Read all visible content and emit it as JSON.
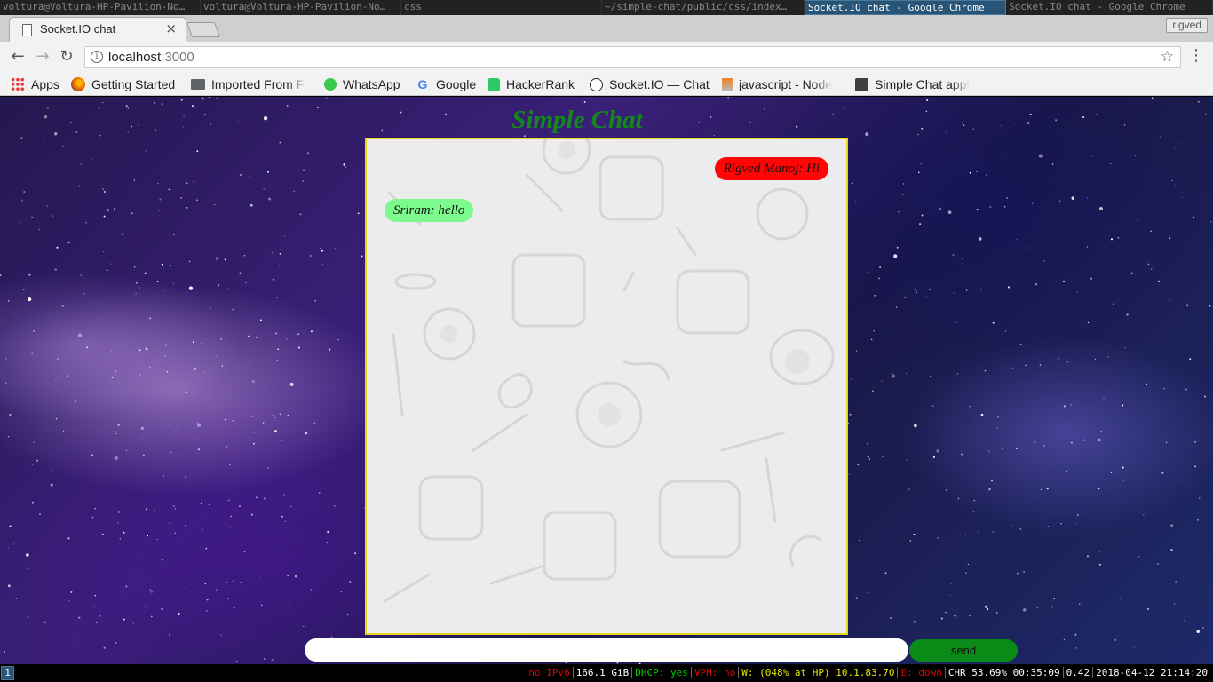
{
  "wm": {
    "titles": [
      "voltura@Voltura-HP-Pavilion-No…",
      "voltura@Voltura-HP-Pavilion-No…",
      "css",
      "~/simple-chat/public/css/index…",
      "Socket.IO chat - Google Chrome",
      "Socket.IO chat - Google Chrome"
    ]
  },
  "browser": {
    "tab_title": "Socket.IO chat",
    "profile_name": "rigved",
    "url_host": "localhost",
    "url_port": ":3000",
    "bookmarks": [
      {
        "label": "Apps",
        "icon": "apps-grid-icon"
      },
      {
        "label": "Getting Started",
        "icon": "firefox-icon"
      },
      {
        "label": "Imported From Fi",
        "icon": "folder-icon"
      },
      {
        "label": "WhatsApp",
        "icon": "whatsapp-icon"
      },
      {
        "label": "Google",
        "icon": "google-icon"
      },
      {
        "label": "HackerRank",
        "icon": "hackerrank-icon"
      },
      {
        "label": "Socket.IO — Chat",
        "icon": "socketio-icon"
      },
      {
        "label": "javascript - Node",
        "icon": "stackoverflow-icon"
      },
      {
        "label": "Simple Chat appl",
        "icon": "document-icon"
      }
    ]
  },
  "page": {
    "title": "Simple Chat",
    "messages": [
      {
        "text": "Rigved Manoj: Hi",
        "side": "right",
        "color": "#ff0505"
      },
      {
        "text": "Sriram: hello",
        "side": "left",
        "color": "#7dfa8e"
      }
    ],
    "input_value": "",
    "send_label": "send",
    "title_color": "#108a18",
    "chat_border_color": "#e6d521",
    "send_button_color": "#0a8a16"
  },
  "status": {
    "workspace": "1",
    "items": [
      {
        "text": "no IPv6",
        "color": "#e00000"
      },
      {
        "text": "166.1 GiB",
        "color": "#ffffff"
      },
      {
        "text": "DHCP: yes",
        "color": "#00d000"
      },
      {
        "text": "VPN: no",
        "color": "#e00000"
      },
      {
        "text": "W: (048% at HP) 10.1.83.70",
        "color": "#e6e600"
      },
      {
        "text": "E: down",
        "color": "#e00000"
      },
      {
        "text": "CHR 53.69% 00:35:09",
        "color": "#ffffff"
      },
      {
        "text": "0.42",
        "color": "#ffffff"
      },
      {
        "text": "2018-04-12 21:14:20",
        "color": "#ffffff"
      }
    ]
  }
}
